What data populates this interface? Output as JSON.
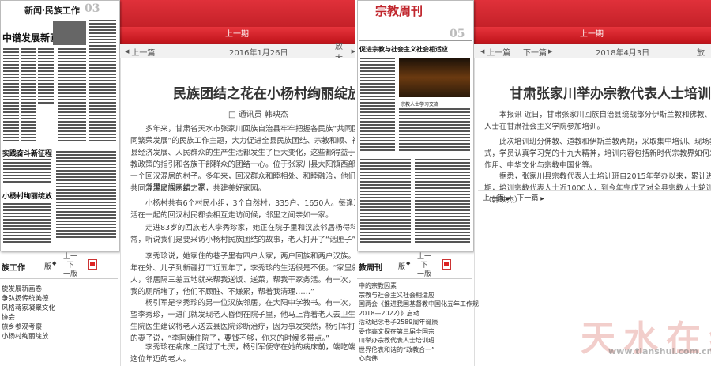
{
  "left": {
    "thumbnail": {
      "section_header": "新闻·民族工作",
      "page_number": "03",
      "headline_fragment": "中谱发展新画卷",
      "label_1": "实践奋斗新征程",
      "label_2": "小杨村绚丽绽放"
    },
    "nav_upper": "上一期",
    "toolbar": {
      "prev": "上一篇",
      "date": "2016年1月26日",
      "next": "放大"
    },
    "article": {
      "title": "民族团结之花在小杨村绚丽绽放",
      "byline": "□ 通讯员  韩映杰",
      "paragraphs": [
        "多年来，甘肃省天水市张家川回族自治县牢牢把握各民族“共同团结奋斗、共同繁荣发展”的民族工作主题，大力促进全县民族团结、宗教和顺、社会和谐，全县经济发展、人民群众的生产生活都发生了巨大变化，这些都得益于党的民族宗教政策的指引和各族干部群众的团结一心。位于张家川县大阳镇西部的小杨村是一个回汉混居的村子。多年来，回汉群众和睦相处、和睦融洽，他们以实际行动共同浇灌民族团结之花，共建美好家园。",
        "邻里之间亲如一家",
        "小杨村共有6个村民小组，3个自然村，335户、1650人。每逢过年过节，生活在一起的回汉村民都会相互走访问候，邻里之间亲如一家。",
        "走进83岁的回族老人李秀珍家，她正在院子里和汉族邻居杨得科老人拉家常，听说我们是要采访小杨村民族团结的故事，老人打开了“话匣子”。",
        "李秀珍说，她家住的巷子里有四户人家，两户回族和两户汉族。由于女儿常年在外、儿子到新疆打工近五年了，李秀珍的生活很是不便。“家里就剩我一个人，邻居隔三差五地就来帮我送饭、送菜，帮我干家务活。有一次，杨登科发现我的厕所堵了，他们不顾脏、不嫌累，帮着我清理……”",
        "杨引军是李秀珍的另一位汉族邻居，在大阳中学教书。有一次，杨引军去看望李秀珍，一进门就发现老人昏倒在院子里，他马上背着老人去卫生院看病。卫生院医生建议将老人送去县医院诊断治疗，因为事发突然，杨引军打电话给自己的妻子说，“李阿姨住院了，要钱不够，你来的时候多带点。”",
        "李秀珍在病床上度过了七天，杨引军便守在她的病床前，端吃端喝，伺候着这位年迈的老人。"
      ]
    },
    "bottom_bar": {
      "section": "族工作",
      "version": "版",
      "pager": [
        "上一",
        "下",
        "一版"
      ]
    },
    "toc": [
      "旋发展新画卷",
      "",
      "争弘扬传统美德",
      "风格蒋家凝聚文化",
      "协会",
      "族乡参观考察",
      "小杨村绚丽绽放"
    ]
  },
  "right": {
    "thumbnail": {
      "masthead": "宗教周刊",
      "page_number": "05",
      "headline_fragment": "促进宗教与社会主义社会相适应",
      "photo_caption": "宗教人士学习交流"
    },
    "nav_upper": "上一期",
    "toolbar": {
      "prev": "上一篇",
      "next": "下一篇",
      "date": "2018年4月3日",
      "zoom": "放"
    },
    "article": {
      "title": "甘肃张家川举办宗教代表人士培训班",
      "paragraphs": [
        "本报讯  近日，甘肃张家川回族自治县统战部分伊斯兰教和佛教、道教代表人士在甘肃社会主义学院参加培训。",
        "此次培训班分佛教、道教和伊斯兰教两期，采取集中培训、现场教学的形式，学员认真学习党的十九大精神，培训内容包括新时代宗教界如何发挥积极作用、中华文化与宗教中国化等。",
        "据悉，张家川县宗教代表人士培训班自2015年举办以来，累计进行11期，培训宗教代表人士近1000人，到今年完成了对全县宗教人士轮训计划。（韩映杰）"
      ],
      "pager": {
        "prev": "上一篇",
        "next": "下一篇"
      }
    },
    "bottom_bar": {
      "section": "教周刊",
      "version": "版",
      "pager": [
        "上一",
        "下",
        "一版"
      ]
    },
    "toc": [
      "中的宗教因素",
      "宗教与社会主义社会相适应",
      "国两会《推进我国基督教中国化五年工作规",
      "2018—2022）》启动",
      "活动纪念老子2589周年诞辰",
      "委作高文探在第三届全国宗",
      "川举办宗教代表人士培训班",
      "世界伦表和谐的“政教合一”",
      "心向佛"
    ]
  },
  "watermark": {
    "text": "天水在线",
    "url": "www.tianshui.com.cn"
  }
}
